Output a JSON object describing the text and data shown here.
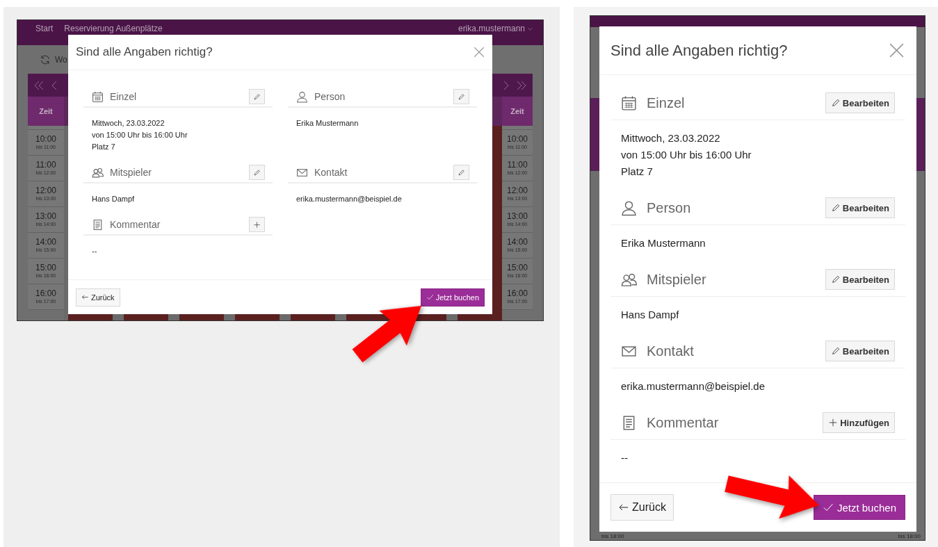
{
  "left_screenshot": {
    "background_app": {
      "nav_links": [
        "Start",
        "Reservierung Außenplätze"
      ],
      "user_menu": "erika.mustermann",
      "toolbar_label": "Wo",
      "time_columns": [
        {
          "header": "Zeit",
          "slots": [
            {
              "start": "10:00",
              "end": "bis 11:00"
            },
            {
              "start": "11:00",
              "end": "bis 12:00"
            },
            {
              "start": "12:00",
              "end": "bis 13:00"
            },
            {
              "start": "13:00",
              "end": "bis 14:00"
            },
            {
              "start": "14:00",
              "end": "bis 15:00"
            },
            {
              "start": "15:00",
              "end": "bis 16:00"
            },
            {
              "start": "16:00",
              "end": "bis 17:00"
            }
          ]
        },
        {
          "header": "Zeit",
          "slots": [
            {
              "start": "10:00",
              "end": "bis 11:00"
            },
            {
              "start": "11:00",
              "end": "bis 12:00"
            },
            {
              "start": "12:00",
              "end": "bis 13:00"
            },
            {
              "start": "13:00",
              "end": "bis 14:00"
            },
            {
              "start": "14:00",
              "end": "bis 15:00"
            },
            {
              "start": "15:00",
              "end": "bis 16:00"
            },
            {
              "start": "16:00",
              "end": "bis 17:00"
            }
          ]
        }
      ]
    },
    "dialog": {
      "title": "Sind alle Angaben richtig?",
      "sections": [
        {
          "kind": "schedule",
          "label": "Einzel",
          "lines": [
            "Mittwoch, 23.03.2022",
            "von 15:00 Uhr bis 16:00 Uhr",
            "Platz 7"
          ],
          "action": {
            "kind": "edit"
          }
        },
        {
          "kind": "person",
          "label": "Person",
          "lines": [
            "Erika Mustermann"
          ],
          "action": {
            "kind": "edit"
          }
        },
        {
          "kind": "players",
          "label": "Mitspieler",
          "lines": [
            "Hans Dampf"
          ],
          "action": {
            "kind": "edit"
          }
        },
        {
          "kind": "contact",
          "label": "Kontakt",
          "lines": [
            "erika.mustermann@beispiel.de"
          ],
          "action": {
            "kind": "edit"
          }
        },
        {
          "kind": "comment",
          "label": "Kommentar",
          "lines": [
            "--"
          ],
          "action": {
            "kind": "add"
          }
        }
      ],
      "back_button": "Zurück",
      "confirm_button": "Jetzt buchen"
    }
  },
  "right_screenshot": {
    "background_app": {
      "time_labels": [
        "bis 18:00",
        "bis 18:00"
      ]
    },
    "dialog": {
      "title": "Sind alle Angaben richtig?",
      "sections": [
        {
          "kind": "schedule",
          "label": "Einzel",
          "lines": [
            "Mittwoch, 23.03.2022",
            "von 15:00 Uhr bis 16:00 Uhr",
            "Platz 7"
          ],
          "action": {
            "kind": "edit",
            "label": "Bearbeiten"
          }
        },
        {
          "kind": "person",
          "label": "Person",
          "lines": [
            "Erika Mustermann"
          ],
          "action": {
            "kind": "edit",
            "label": "Bearbeiten"
          }
        },
        {
          "kind": "players",
          "label": "Mitspieler",
          "lines": [
            "Hans Dampf"
          ],
          "action": {
            "kind": "edit",
            "label": "Bearbeiten"
          }
        },
        {
          "kind": "contact",
          "label": "Kontakt",
          "lines": [
            "erika.mustermann@beispiel.de"
          ],
          "action": {
            "kind": "edit",
            "label": "Bearbeiten"
          }
        },
        {
          "kind": "comment",
          "label": "Kommentar",
          "lines": [
            "--"
          ],
          "action": {
            "kind": "add",
            "label": "Hinzufügen"
          }
        }
      ],
      "back_button": "Zurück",
      "confirm_button": "Jetzt buchen"
    }
  }
}
